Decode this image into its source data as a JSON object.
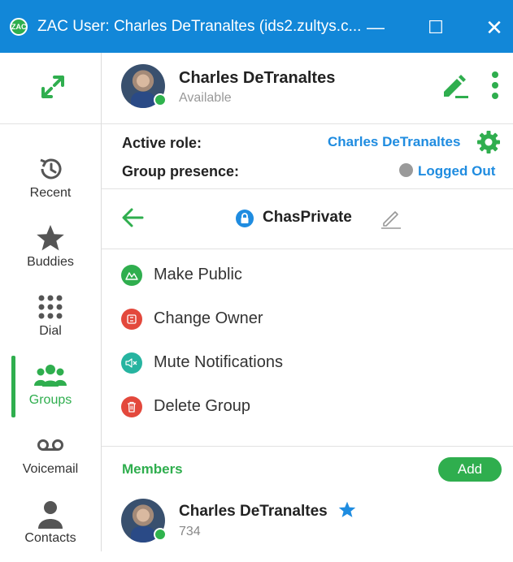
{
  "window": {
    "title": "ZAC User: Charles DeTranaltes (ids2.zultys.c...",
    "app_icon_text": "ZAC",
    "controls": {
      "minimize": "—",
      "maximize": "☐",
      "close": "✕"
    }
  },
  "nav": {
    "expand_icon": "expand-arrows-icon",
    "items": [
      {
        "label": "Recent",
        "icon": "history-icon"
      },
      {
        "label": "Buddies",
        "icon": "star-icon"
      },
      {
        "label": "Dial",
        "icon": "dialpad-icon"
      },
      {
        "label": "Groups",
        "icon": "people-icon",
        "active": true
      },
      {
        "label": "Voicemail",
        "icon": "voicemail-icon"
      },
      {
        "label": "Contacts",
        "icon": "contact-icon"
      }
    ]
  },
  "profile": {
    "name": "Charles DeTranaltes",
    "status": "Available"
  },
  "roles": {
    "active_role_label": "Active role:",
    "active_role_value": "Charles DeTranaltes",
    "group_presence_label": "Group presence:",
    "group_presence_value": "Logged Out"
  },
  "group": {
    "name": "ChasPrivate"
  },
  "actions": [
    {
      "label": "Make Public",
      "color": "#2fae4e",
      "icon": "group-public-icon"
    },
    {
      "label": "Change Owner",
      "color": "#e3483c",
      "icon": "change-owner-icon"
    },
    {
      "label": "Mute Notifications",
      "color": "#26b4a0",
      "icon": "mute-icon"
    },
    {
      "label": "Delete Group",
      "color": "#e3483c",
      "icon": "trash-icon"
    }
  ],
  "members": {
    "label": "Members",
    "add_label": "Add",
    "list": [
      {
        "name": "Charles DeTranaltes",
        "ext": "734"
      }
    ]
  },
  "colors": {
    "titlebar": "#1287d8",
    "accent_green": "#2fae4e",
    "link_blue": "#1f8ce0"
  }
}
